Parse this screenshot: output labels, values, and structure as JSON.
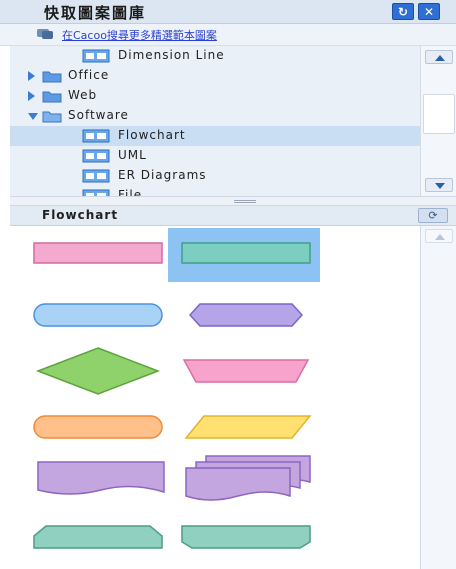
{
  "window": {
    "title": "快取圖案圖庫",
    "refresh_glyph": "↻",
    "close_glyph": "✕"
  },
  "link": {
    "text": "在Cacoo搜尋更多精選範本圖案"
  },
  "tree": {
    "items": [
      {
        "label": "Dimension Line",
        "kind": "doc",
        "level": 1
      },
      {
        "label": "Office",
        "kind": "folder",
        "level": 0,
        "state": "collapsed"
      },
      {
        "label": "Web",
        "kind": "folder",
        "level": 0,
        "state": "collapsed"
      },
      {
        "label": "Software",
        "kind": "folder",
        "level": 0,
        "state": "expanded"
      },
      {
        "label": "Flowchart",
        "kind": "doc",
        "level": 1,
        "selected": true
      },
      {
        "label": "UML",
        "kind": "doc",
        "level": 1
      },
      {
        "label": "ER Diagrams",
        "kind": "doc",
        "level": 1
      },
      {
        "label": "File",
        "kind": "doc",
        "level": 1
      }
    ]
  },
  "section": {
    "title": "Flowchart",
    "button_glyph": "⟳"
  },
  "shapes": [
    {
      "name": "process",
      "fill": "#f4a9cf",
      "stroke": "#d46aa2"
    },
    {
      "name": "process-selected",
      "fill": "#7ccfc0",
      "stroke": "#3f9f8e",
      "selected": true
    },
    {
      "name": "terminator",
      "fill": "#a9d2f7",
      "stroke": "#4b92e0"
    },
    {
      "name": "preparation",
      "fill": "#b5a5e8",
      "stroke": "#7b65c7"
    },
    {
      "name": "decision",
      "fill": "#8fd16a",
      "stroke": "#5aa33a"
    },
    {
      "name": "manual-operation",
      "fill": "#f7a3cb",
      "stroke": "#d96fa3"
    },
    {
      "name": "terminator-orange",
      "fill": "#ffc08a",
      "stroke": "#f08a3a"
    },
    {
      "name": "data",
      "fill": "#ffe070",
      "stroke": "#e2b52a"
    },
    {
      "name": "document",
      "fill": "#c3a6e0",
      "stroke": "#8d66bf"
    },
    {
      "name": "multi-document",
      "fill": "#c3a6e0",
      "stroke": "#8d66bf"
    },
    {
      "name": "card",
      "fill": "#8fd0c0",
      "stroke": "#4c9c89"
    },
    {
      "name": "loop-limit",
      "fill": "#8fd0c0",
      "stroke": "#4c9c89"
    }
  ],
  "colors": {
    "accent": "#3a7bd5",
    "selection": "#8cc3f3",
    "link": "#2a3fd6"
  }
}
